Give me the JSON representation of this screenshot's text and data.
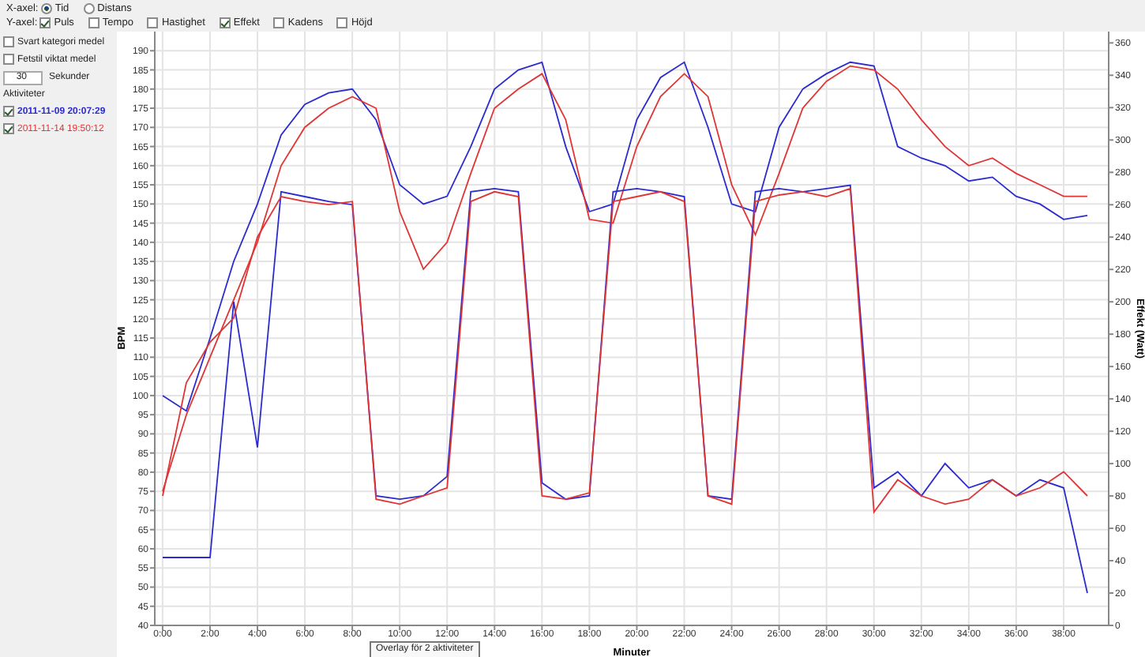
{
  "x_axis": {
    "label": "X-axel:",
    "options": [
      {
        "label": "Tid",
        "selected": true
      },
      {
        "label": "Distans",
        "selected": false
      }
    ]
  },
  "y_axis": {
    "label": "Y-axel:",
    "options": [
      {
        "label": "Puls",
        "checked": true
      },
      {
        "label": "Tempo",
        "checked": false
      },
      {
        "label": "Hastighet",
        "checked": false
      },
      {
        "label": "Effekt",
        "checked": true
      },
      {
        "label": "Kadens",
        "checked": false
      },
      {
        "label": "Höjd",
        "checked": false
      }
    ]
  },
  "options": [
    {
      "label": "Svart kategori medel",
      "checked": false
    },
    {
      "label": "Fetstil viktat medel",
      "checked": false
    }
  ],
  "smoothing": {
    "value": "30",
    "unit": "Sekunder"
  },
  "activities": {
    "title": "Aktiviteter",
    "items": [
      {
        "label": "2011-11-09 20:07:29",
        "checked": true,
        "color": "#2b2bd0",
        "bold": true
      },
      {
        "label": "2011-11-14 19:50:12",
        "checked": true,
        "color": "#e03535",
        "bold": false
      }
    ]
  },
  "chart": {
    "tooltip": "Overlay för 2 aktiviteter",
    "chart_data": {
      "type": "line",
      "grid": true,
      "xlabel": "Minuter",
      "ylabel": "BPM",
      "y2label": "Effekt (Watt)",
      "xlim": [
        -0.33,
        39.9
      ],
      "ylim": [
        40,
        195
      ],
      "y2lim": [
        0,
        367
      ],
      "xticks": [
        {
          "value": 0,
          "label": "0:00"
        },
        {
          "value": 2,
          "label": "2:00"
        },
        {
          "value": 4,
          "label": "4:00"
        },
        {
          "value": 6,
          "label": "6:00"
        },
        {
          "value": 8,
          "label": "8:00"
        },
        {
          "value": 10,
          "label": "10:00"
        },
        {
          "value": 12,
          "label": "12:00"
        },
        {
          "value": 14,
          "label": "14:00"
        },
        {
          "value": 16,
          "label": "16:00"
        },
        {
          "value": 18,
          "label": "18:00"
        },
        {
          "value": 20,
          "label": "20:00"
        },
        {
          "value": 22,
          "label": "22:00"
        },
        {
          "value": 24,
          "label": "24:00"
        },
        {
          "value": 26,
          "label": "26:00"
        },
        {
          "value": 28,
          "label": "28:00"
        },
        {
          "value": 30,
          "label": "30:00"
        },
        {
          "value": 32,
          "label": "32:00"
        },
        {
          "value": 34,
          "label": "34:00"
        },
        {
          "value": 36,
          "label": "36:00"
        },
        {
          "value": 38,
          "label": "38:00"
        }
      ],
      "yticks": [
        40,
        45,
        50,
        55,
        60,
        65,
        70,
        75,
        80,
        85,
        90,
        95,
        100,
        105,
        110,
        115,
        120,
        125,
        130,
        135,
        140,
        145,
        150,
        155,
        160,
        165,
        170,
        175,
        180,
        185,
        190
      ],
      "y2ticks": [
        0,
        20,
        40,
        60,
        80,
        100,
        120,
        140,
        160,
        180,
        200,
        220,
        240,
        260,
        280,
        300,
        320,
        340,
        360
      ],
      "x": [
        0,
        1,
        2,
        3,
        4,
        5,
        6,
        7,
        8,
        9,
        10,
        11,
        12,
        13,
        14,
        15,
        16,
        17,
        18,
        19,
        20,
        21,
        22,
        23,
        24,
        25,
        26,
        27,
        28,
        29,
        30,
        31,
        32,
        33,
        34,
        35,
        36,
        37,
        38,
        39
      ],
      "series": [
        {
          "color": "#2b2bd0",
          "values": [
            100,
            96,
            115,
            135,
            150,
            168,
            176,
            179,
            180,
            172,
            155,
            150,
            152,
            165,
            180,
            185,
            187,
            165,
            148,
            150,
            172,
            183,
            187,
            170,
            150,
            148,
            170,
            180,
            184,
            187,
            186,
            165,
            162,
            160,
            156,
            157,
            152,
            150,
            146,
            147
          ]
        },
        {
          "color": "#e03535",
          "values": [
            75,
            95,
            110,
            125,
            140,
            160,
            170,
            175,
            178,
            175,
            148,
            133,
            140,
            158,
            175,
            180,
            184,
            172,
            146,
            145,
            165,
            178,
            184,
            178,
            155,
            142,
            158,
            175,
            182,
            186,
            185,
            180,
            172,
            165,
            160,
            162,
            158,
            155,
            152,
            152
          ]
        },
        {
          "color": "#2b2bd0",
          "axis": "y2",
          "values": [
            42,
            42,
            42,
            200,
            110,
            268,
            265,
            262,
            260,
            80,
            78,
            80,
            92,
            268,
            270,
            268,
            88,
            78,
            80,
            268,
            270,
            268,
            265,
            80,
            78,
            268,
            270,
            268,
            270,
            272,
            85,
            95,
            80,
            100,
            85,
            90,
            80,
            90,
            85,
            20
          ]
        },
        {
          "color": "#e03535",
          "axis": "y2",
          "values": [
            80,
            150,
            175,
            190,
            240,
            265,
            262,
            260,
            262,
            78,
            75,
            80,
            85,
            262,
            268,
            265,
            80,
            78,
            82,
            262,
            265,
            268,
            262,
            80,
            75,
            262,
            266,
            268,
            265,
            270,
            70,
            90,
            80,
            75,
            78,
            90,
            80,
            85,
            95,
            80
          ]
        }
      ]
    }
  }
}
